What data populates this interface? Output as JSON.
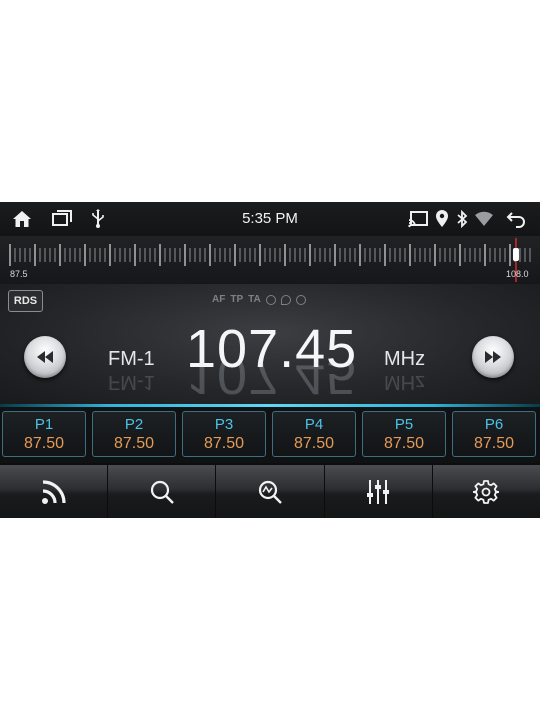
{
  "status_bar": {
    "time": "5:35 PM",
    "left_icons": [
      "home-icon",
      "recent-apps-icon",
      "usb-icon"
    ],
    "right_icons": [
      "cast-icon",
      "location-icon",
      "bluetooth-icon",
      "wifi-icon",
      "back-icon"
    ]
  },
  "tuner": {
    "scale_min": "87.5",
    "scale_max": "108.0",
    "tuned_fraction": 0.973
  },
  "display": {
    "rds_label": "RDS",
    "flags": [
      "AF",
      "TP",
      "TA"
    ],
    "flag_icons": [
      "loop-icon",
      "search-icon",
      "scan-icon"
    ],
    "band": "FM-1",
    "frequency": "107.45",
    "unit": "MHz"
  },
  "presets": [
    {
      "label": "P1",
      "freq": "87.50"
    },
    {
      "label": "P2",
      "freq": "87.50"
    },
    {
      "label": "P3",
      "freq": "87.50"
    },
    {
      "label": "P4",
      "freq": "87.50"
    },
    {
      "label": "P5",
      "freq": "87.50"
    },
    {
      "label": "P6",
      "freq": "87.50"
    }
  ],
  "toolbar": [
    "rss-icon",
    "search-icon",
    "scan-icon",
    "equalizer-icon",
    "settings-icon"
  ],
  "colors": {
    "accent": "#4cc3e6",
    "preset_freq": "#e59a55",
    "needle": "#ff3030"
  }
}
